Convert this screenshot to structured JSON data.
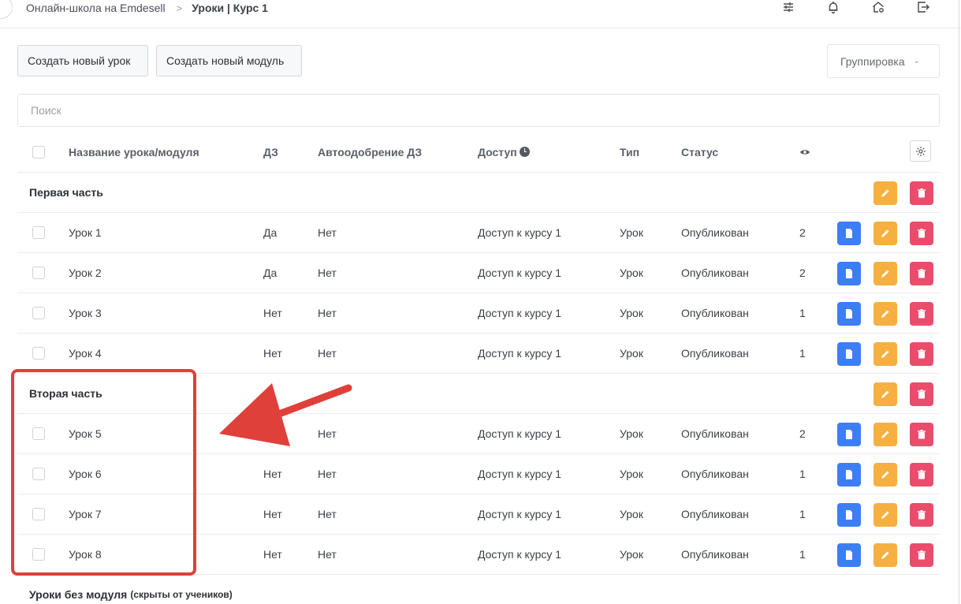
{
  "breadcrumb": {
    "parent": "Онлайн-школа на Emdesell",
    "separator": ">",
    "current": "Уроки | Курс 1"
  },
  "header_icons": [
    "sliders-icon",
    "bell-icon",
    "home-settings-icon",
    "logout-icon"
  ],
  "toolbar": {
    "create_lesson": "Создать новый урок",
    "create_module": "Создать новый модуль",
    "grouping": "Группировка"
  },
  "search": {
    "placeholder": "Поиск",
    "value": ""
  },
  "table": {
    "headers": {
      "name": "Название урока/модуля",
      "dz": "ДЗ",
      "auto": "Автоодобрение ДЗ",
      "access": "Доступ",
      "type": "Тип",
      "status": "Статус",
      "views_icon": "eye-icon"
    },
    "modules": [
      {
        "title": "Первая часть",
        "lessons": [
          {
            "name": "Урок 1",
            "dz": "Да",
            "auto": "Нет",
            "access": "Доступ к курсу 1",
            "type": "Урок",
            "status": "Опубликован",
            "views": "2"
          },
          {
            "name": "Урок 2",
            "dz": "Да",
            "auto": "Нет",
            "access": "Доступ к курсу 1",
            "type": "Урок",
            "status": "Опубликован",
            "views": "2"
          },
          {
            "name": "Урок 3",
            "dz": "Нет",
            "auto": "Нет",
            "access": "Доступ к курсу 1",
            "type": "Урок",
            "status": "Опубликован",
            "views": "1"
          },
          {
            "name": "Урок 4",
            "dz": "Нет",
            "auto": "Нет",
            "access": "Доступ к курсу 1",
            "type": "Урок",
            "status": "Опубликован",
            "views": "1"
          }
        ]
      },
      {
        "title": "Вторая часть",
        "lessons": [
          {
            "name": "Урок 5",
            "dz": "",
            "auto": "Нет",
            "access": "Доступ к курсу 1",
            "type": "Урок",
            "status": "Опубликован",
            "views": "2"
          },
          {
            "name": "Урок 6",
            "dz": "Нет",
            "auto": "Нет",
            "access": "Доступ к курсу 1",
            "type": "Урок",
            "status": "Опубликован",
            "views": "1"
          },
          {
            "name": "Урок 7",
            "dz": "Нет",
            "auto": "Нет",
            "access": "Доступ к курсу 1",
            "type": "Урок",
            "status": "Опубликован",
            "views": "1"
          },
          {
            "name": "Урок 8",
            "dz": "Нет",
            "auto": "Нет",
            "access": "Доступ к курсу 1",
            "type": "Урок",
            "status": "Опубликован",
            "views": "1"
          }
        ]
      }
    ],
    "unassigned": {
      "title": "Уроки без модуля",
      "note": "(скрыты от учеников)"
    }
  },
  "colors": {
    "doc_button": "#3d7ef5",
    "edit_button": "#f5b041",
    "delete_button": "#ec4c6c",
    "annotation": "#e0403a"
  }
}
